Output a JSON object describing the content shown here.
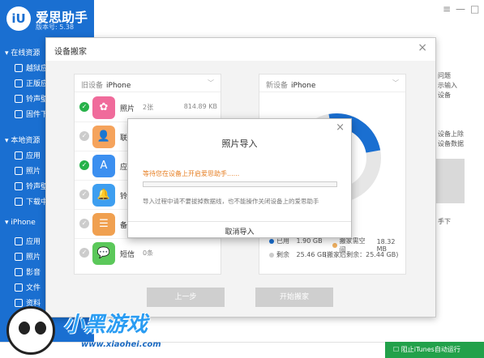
{
  "app": {
    "title": "爱思助手",
    "version": "版本号: 5.38",
    "logo_text": "iU"
  },
  "sidebar": {
    "sections": [
      {
        "label": "在线资源",
        "items": [
          "越狱应",
          "正版应",
          "铃声壁",
          "固件下"
        ]
      },
      {
        "label": "本地资源",
        "items": [
          "应用",
          "照片",
          "铃声壁",
          "下载中"
        ]
      },
      {
        "label": "iPhone",
        "items": [
          "应用",
          "照片",
          "影音",
          "文件",
          "资料"
        ]
      }
    ]
  },
  "background": {
    "texts": [
      "问题",
      "示输入",
      "设备",
      "设备上除",
      "设备数据",
      "手下"
    ],
    "window_controls": [
      "≡",
      "—",
      "□"
    ]
  },
  "dialog": {
    "title": "设备搬家",
    "close": "×",
    "old_device": {
      "prefix": "旧设备",
      "name": "iPhone"
    },
    "new_device": {
      "prefix": "新设备",
      "name": "iPhone"
    },
    "items": [
      {
        "name": "照片",
        "count": "2张",
        "size": "814.89 KB",
        "checked": true,
        "icon": "photos-icon",
        "color": "#f06b9b",
        "glyph": "✿"
      },
      {
        "name": "联",
        "count": "",
        "size": "",
        "checked": false,
        "icon": "contacts-icon",
        "color": "#f5a35c",
        "glyph": "👤"
      },
      {
        "name": "应",
        "count": "",
        "size": "",
        "checked": true,
        "icon": "appstore-icon",
        "color": "#3b8ff0",
        "glyph": "A"
      },
      {
        "name": "铃",
        "count": "",
        "size": "",
        "checked": false,
        "icon": "bell-icon",
        "color": "#3d9ef0",
        "glyph": "🔔"
      },
      {
        "name": "备",
        "count": "",
        "size": "",
        "checked": false,
        "icon": "notes-icon",
        "color": "#f0a050",
        "glyph": "☰"
      },
      {
        "name": "短信",
        "count": "0条",
        "size": "",
        "checked": false,
        "icon": "messages-icon",
        "color": "#5bc85a",
        "glyph": "💬"
      }
    ],
    "storage": {
      "used_label": "已用",
      "used_value": "1.90 GB",
      "need_label": "搬家需空间",
      "need_value": "18.32 MB",
      "free_label": "剩余",
      "free_value": "25.46 GB",
      "after_label": "(搬家后剩余：25.44 GB)",
      "used_color": "#1a6fd1",
      "need_color": "#f0b060",
      "free_color": "#cccccc"
    },
    "prev_button": "上一步",
    "start_button": "开始搬家"
  },
  "import_dialog": {
    "title": "照片导入",
    "close": "×",
    "status": "等待您在设备上开启爱思助手......",
    "progress": 0,
    "hint": "导入过程中请不要拔掉数据线，也不能操作关闭设备上的爱思助手",
    "cancel_button": "取消导入"
  },
  "footer": {
    "itunes_toggle": "阻止iTunes自动运行"
  },
  "watermark": {
    "text": "小黑游戏",
    "url": "www.xiaohei.com"
  }
}
